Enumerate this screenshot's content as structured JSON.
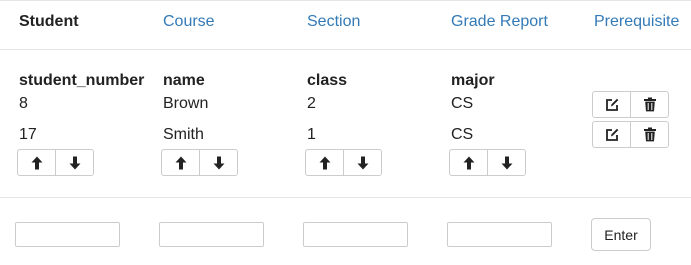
{
  "nav": {
    "tabs": [
      {
        "label": "Student",
        "active": true
      },
      {
        "label": "Course",
        "active": false
      },
      {
        "label": "Section",
        "active": false
      },
      {
        "label": "Grade Report",
        "active": false
      },
      {
        "label": "Prerequisite",
        "active": false
      }
    ]
  },
  "table": {
    "columns": [
      "student_number",
      "name",
      "class",
      "major"
    ],
    "rows": [
      [
        "8",
        "Brown",
        "2",
        "CS"
      ],
      [
        "17",
        "Smith",
        "1",
        "CS"
      ]
    ],
    "sort_icons": {
      "up": "arrow-up-icon",
      "down": "arrow-down-icon"
    },
    "row_action_icons": {
      "edit": "edit-icon",
      "delete": "trash-icon"
    }
  },
  "form": {
    "inputs": [
      {
        "value": "",
        "placeholder": ""
      },
      {
        "value": "",
        "placeholder": ""
      },
      {
        "value": "",
        "placeholder": ""
      },
      {
        "value": "",
        "placeholder": ""
      }
    ],
    "submit_label": "Enter"
  },
  "colors": {
    "link": "#337ab7",
    "text": "#222222",
    "border": "#cccccc",
    "divider": "#e6e6e6"
  }
}
